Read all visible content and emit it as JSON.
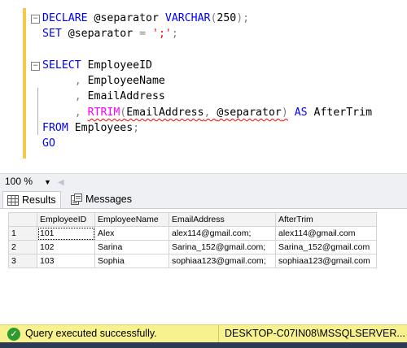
{
  "editor": {
    "lines": [
      {
        "fold": "−",
        "parts": [
          [
            "kw",
            "DECLARE "
          ],
          [
            "",
            "@separator "
          ],
          [
            "kw",
            "VARCHAR"
          ],
          [
            "gr",
            "("
          ],
          [
            "",
            "250"
          ],
          [
            "gr",
            ");"
          ]
        ]
      },
      {
        "fold": "",
        "parts": [
          [
            "kw",
            "SET "
          ],
          [
            "",
            "@separator "
          ],
          [
            "gr",
            "= "
          ],
          [
            "str",
            "';'"
          ],
          [
            "gr",
            ";"
          ]
        ]
      },
      {
        "fold": "",
        "parts": []
      },
      {
        "fold": "−",
        "parts": [
          [
            "kw",
            "SELECT "
          ],
          [
            "",
            "EmployeeID"
          ]
        ]
      },
      {
        "fold": "",
        "parts": [
          [
            "",
            "     "
          ],
          [
            "gr",
            ", "
          ],
          [
            "",
            "EmployeeName"
          ]
        ]
      },
      {
        "fold": "",
        "parts": [
          [
            "",
            "     "
          ],
          [
            "gr",
            ", "
          ],
          [
            "",
            "EmailAddress"
          ]
        ]
      },
      {
        "fold": "",
        "parts": [
          [
            "",
            "     "
          ],
          [
            "gr",
            ", "
          ],
          [
            "fn sq",
            "RTRIM"
          ],
          [
            "gr sq",
            "("
          ],
          [
            "sq",
            "EmailAddress"
          ],
          [
            "gr sq",
            ", "
          ],
          [
            "sq",
            "@separator"
          ],
          [
            "gr sq",
            ")"
          ],
          [
            "kw",
            " AS "
          ],
          [
            "",
            "AfterTrim"
          ]
        ]
      },
      {
        "fold": "",
        "parts": [
          [
            "kw",
            "FROM "
          ],
          [
            "",
            "Employees"
          ],
          [
            "gr",
            ";"
          ]
        ]
      },
      {
        "fold": "",
        "parts": [
          [
            "kw",
            "GO"
          ]
        ]
      }
    ]
  },
  "zoom": {
    "value": "100 %"
  },
  "tabs": {
    "results": "Results",
    "messages": "Messages"
  },
  "grid": {
    "columns": [
      "EmployeeID",
      "EmployeeName",
      "EmailAddress",
      "AfterTrim"
    ],
    "rows": [
      {
        "n": "1",
        "cells": [
          "101",
          "Alex",
          "alex114@gmail.com;",
          "alex114@gmail.com"
        ]
      },
      {
        "n": "2",
        "cells": [
          "102",
          "Sarina",
          "Sarina_152@gmail.com;",
          "Sarina_152@gmail.com"
        ]
      },
      {
        "n": "3",
        "cells": [
          "103",
          "Sophia",
          "sophiaa123@gmail.com;",
          "sophiaa123@gmail.com"
        ]
      }
    ]
  },
  "status": {
    "message": "Query executed successfully.",
    "server": "DESKTOP-C07IN08\\MSSQLSERVER...",
    "bg_color": "#f7f18e"
  }
}
